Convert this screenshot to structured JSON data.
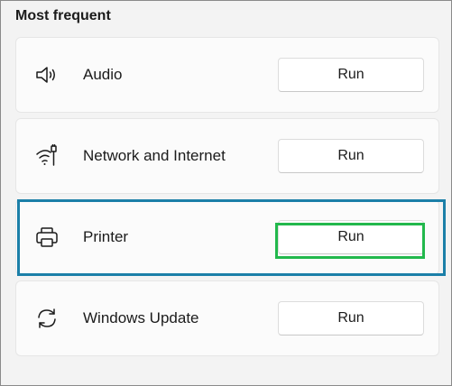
{
  "section": {
    "title": "Most frequent"
  },
  "items": [
    {
      "label": "Audio",
      "icon": "speaker-icon",
      "button": "Run"
    },
    {
      "label": "Network and Internet",
      "icon": "network-icon",
      "button": "Run"
    },
    {
      "label": "Printer",
      "icon": "printer-icon",
      "button": "Run"
    },
    {
      "label": "Windows Update",
      "icon": "sync-icon",
      "button": "Run"
    }
  ],
  "colors": {
    "row_highlight": "#1b7fa8",
    "button_highlight": "#22b84c"
  }
}
